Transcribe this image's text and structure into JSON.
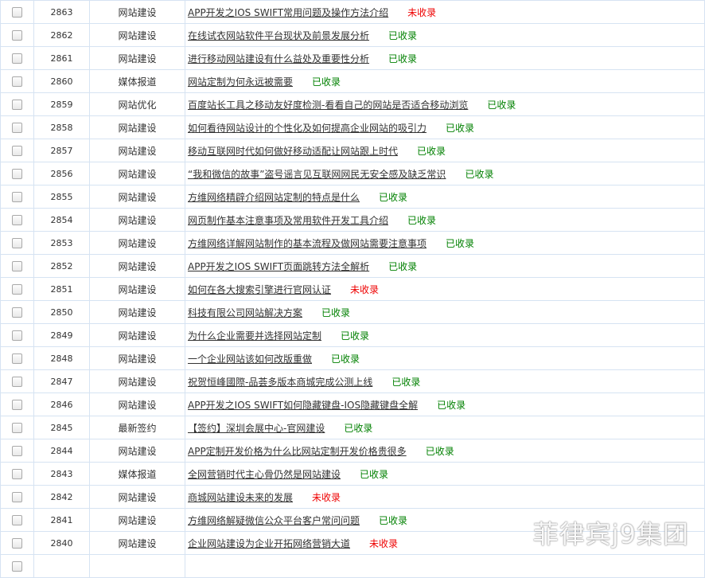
{
  "rows": [
    {
      "id": "2863",
      "category": "网站建设",
      "title": "APP开发之IOS SWIFT常用问题及操作方法介绍",
      "status": "未收录",
      "indexed": false
    },
    {
      "id": "2862",
      "category": "网站建设",
      "title": "在线试衣网站软件平台现状及前景发展分析",
      "status": "已收录",
      "indexed": true
    },
    {
      "id": "2861",
      "category": "网站建设",
      "title": "进行移动网站建设有什么益处及重要性分析",
      "status": "已收录",
      "indexed": true
    },
    {
      "id": "2860",
      "category": "媒体报道",
      "title": "网站定制为何永远被需要",
      "status": "已收录",
      "indexed": true
    },
    {
      "id": "2859",
      "category": "网站优化",
      "title": "百度站长工具之移动友好度检测-看看自己的网站是否适合移动浏览",
      "status": "已收录",
      "indexed": true
    },
    {
      "id": "2858",
      "category": "网站建设",
      "title": "如何看待网站设计的个性化及如何提高企业网站的吸引力",
      "status": "已收录",
      "indexed": true
    },
    {
      "id": "2857",
      "category": "网站建设",
      "title": "移动互联网时代如何做好移动适配让网站跟上时代",
      "status": "已收录",
      "indexed": true
    },
    {
      "id": "2856",
      "category": "网站建设",
      "title": "“我和微信的故事”盗号谣言见互联网网民无安全感及缺乏常识",
      "status": "已收录",
      "indexed": true
    },
    {
      "id": "2855",
      "category": "网站建设",
      "title": "方维网络精辟介绍网站定制的特点是什么",
      "status": "已收录",
      "indexed": true
    },
    {
      "id": "2854",
      "category": "网站建设",
      "title": "网页制作基本注意事项及常用软件开发工具介绍",
      "status": "已收录",
      "indexed": true
    },
    {
      "id": "2853",
      "category": "网站建设",
      "title": "方维网络详解网站制作的基本流程及做网站需要注意事项",
      "status": "已收录",
      "indexed": true
    },
    {
      "id": "2852",
      "category": "网站建设",
      "title": "APP开发之IOS SWIFT页面跳转方法全解析",
      "status": "已收录",
      "indexed": true
    },
    {
      "id": "2851",
      "category": "网站建设",
      "title": "如何在各大搜索引擎进行官网认证",
      "status": "未收录",
      "indexed": false
    },
    {
      "id": "2850",
      "category": "网站建设",
      "title": "科技有限公司网站解决方案",
      "status": "已收录",
      "indexed": true
    },
    {
      "id": "2849",
      "category": "网站建设",
      "title": "为什么企业需要并选择网站定制",
      "status": "已收录",
      "indexed": true
    },
    {
      "id": "2848",
      "category": "网站建设",
      "title": "一个企业网站该如何改版重做",
      "status": "已收录",
      "indexed": true
    },
    {
      "id": "2847",
      "category": "网站建设",
      "title": "祝贺恒峰國際-品荟多版本商城完成公测上线",
      "status": "已收录",
      "indexed": true
    },
    {
      "id": "2846",
      "category": "网站建设",
      "title": "APP开发之IOS SWIFT如何隐藏键盘-IOS隐藏键盘全解",
      "status": "已收录",
      "indexed": true
    },
    {
      "id": "2845",
      "category": "最新签约",
      "title": "【签约】深圳会展中心-官网建设",
      "status": "已收录",
      "indexed": true
    },
    {
      "id": "2844",
      "category": "网站建设",
      "title": "APP定制开发价格为什么比网站定制开发价格贵很多",
      "status": "已收录",
      "indexed": true
    },
    {
      "id": "2843",
      "category": "媒体报道",
      "title": "全网营销时代主心骨仍然是网站建设",
      "status": "已收录",
      "indexed": true
    },
    {
      "id": "2842",
      "category": "网站建设",
      "title": "商城网站建设未来的发展",
      "status": "未收录",
      "indexed": false
    },
    {
      "id": "2841",
      "category": "网站建设",
      "title": "方维网络解疑微信公众平台客户常问问题",
      "status": "已收录",
      "indexed": true
    },
    {
      "id": "2840",
      "category": "网站建设",
      "title": "企业网站建设为企业开拓网络营销大道",
      "status": "未收录",
      "indexed": false
    },
    {
      "id": "",
      "category": "",
      "title": "",
      "status": "",
      "indexed": true
    }
  ],
  "watermark": "菲律宾j9集团",
  "colors": {
    "indexed": "#008000",
    "not_indexed": "#ee0000",
    "grid": "#d6e3f2"
  }
}
